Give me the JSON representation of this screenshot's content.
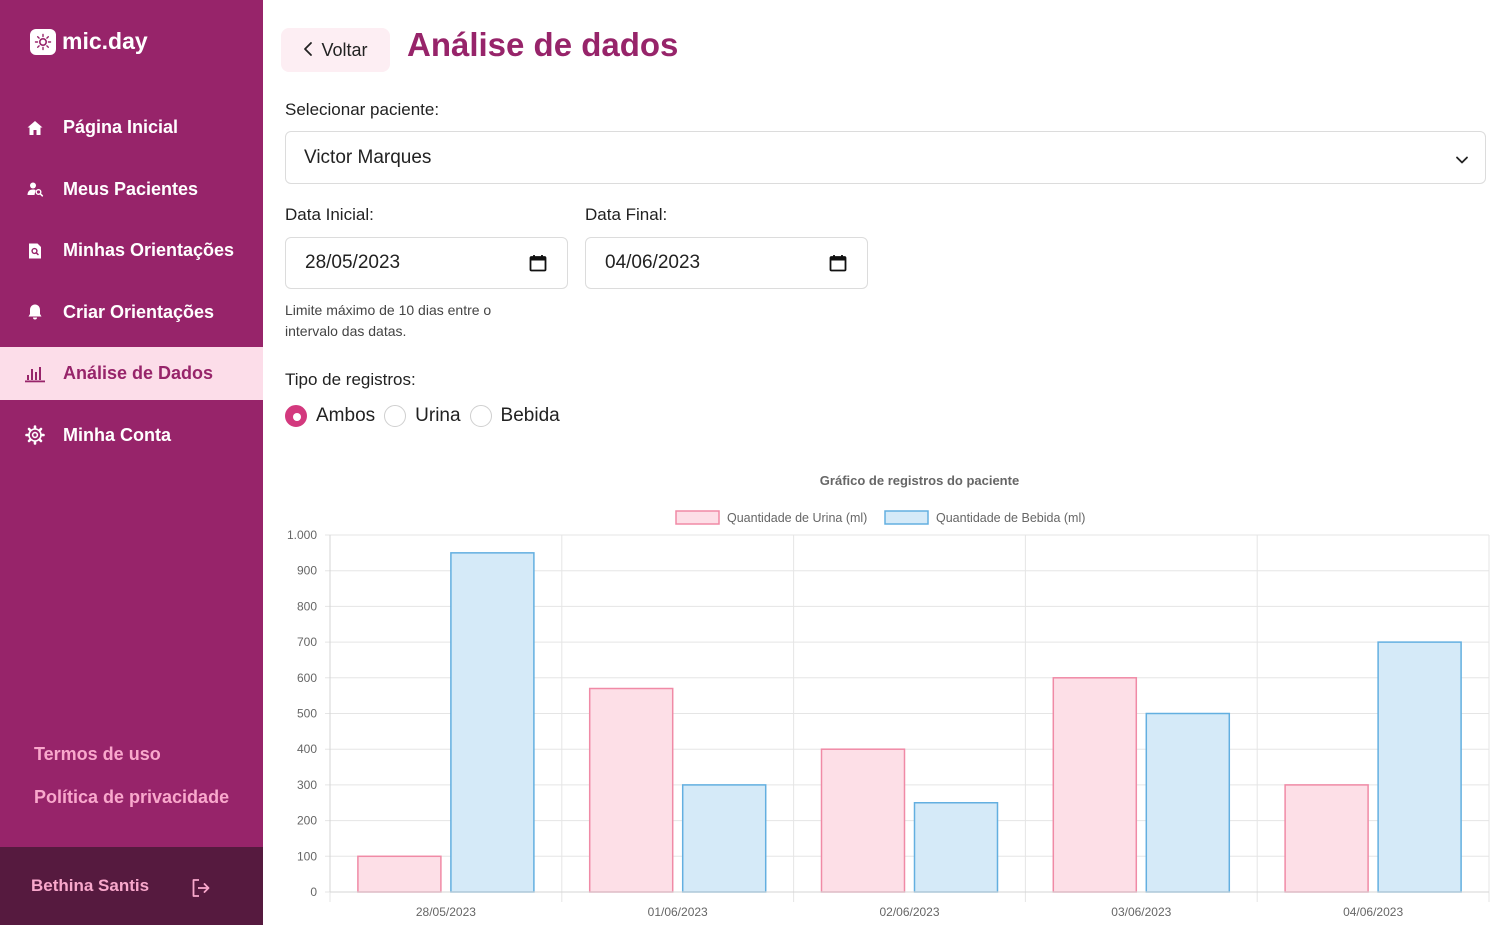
{
  "app": {
    "name": "mic.day"
  },
  "sidebar": {
    "items": [
      {
        "label": "Página Inicial",
        "icon": "home-icon"
      },
      {
        "label": "Meus Pacientes",
        "icon": "user-search-icon"
      },
      {
        "label": "Minhas Orientações",
        "icon": "document-search-icon"
      },
      {
        "label": "Criar Orientações",
        "icon": "bell-icon"
      },
      {
        "label": "Análise de Dados",
        "icon": "bar-chart-icon",
        "active": true
      },
      {
        "label": "Minha Conta",
        "icon": "gear-icon"
      }
    ],
    "footer_links": [
      "Termos de uso",
      "Política de privacidade"
    ],
    "user_name": "Bethina Santis"
  },
  "header": {
    "back_label": "Voltar",
    "title": "Análise de dados"
  },
  "form": {
    "patient_label": "Selecionar paciente:",
    "patient_value": "Victor Marques",
    "start_label": "Data Inicial:",
    "start_value": "28/05/2023",
    "end_label": "Data Final:",
    "end_value": "04/06/2023",
    "hint": "Limite máximo de 10 dias entre o intervalo das datas.",
    "type_label": "Tipo de registros:",
    "type_options": [
      "Ambos",
      "Urina",
      "Bebida"
    ],
    "type_selected": "Ambos"
  },
  "colors": {
    "brand": "#97246a",
    "urine_fill": "#fddfe7",
    "urine_stroke": "#f08aa6",
    "drink_fill": "#d5eaf8",
    "drink_stroke": "#63afe0"
  },
  "chart_data": {
    "type": "bar",
    "title": "Gráfico de registros do paciente",
    "categories": [
      "28/05/2023",
      "01/06/2023",
      "02/06/2023",
      "03/06/2023",
      "04/06/2023"
    ],
    "series": [
      {
        "name": "Quantidade de Urina (ml)",
        "values": [
          100,
          570,
          400,
          600,
          300
        ]
      },
      {
        "name": "Quantidade de Bebida (ml)",
        "values": [
          950,
          300,
          250,
          500,
          700
        ]
      }
    ],
    "ylim": [
      0,
      1000
    ],
    "yticks": [
      "0",
      "100",
      "200",
      "300",
      "400",
      "500",
      "600",
      "700",
      "800",
      "900",
      "1.000"
    ],
    "grid": true,
    "legend": "top"
  }
}
